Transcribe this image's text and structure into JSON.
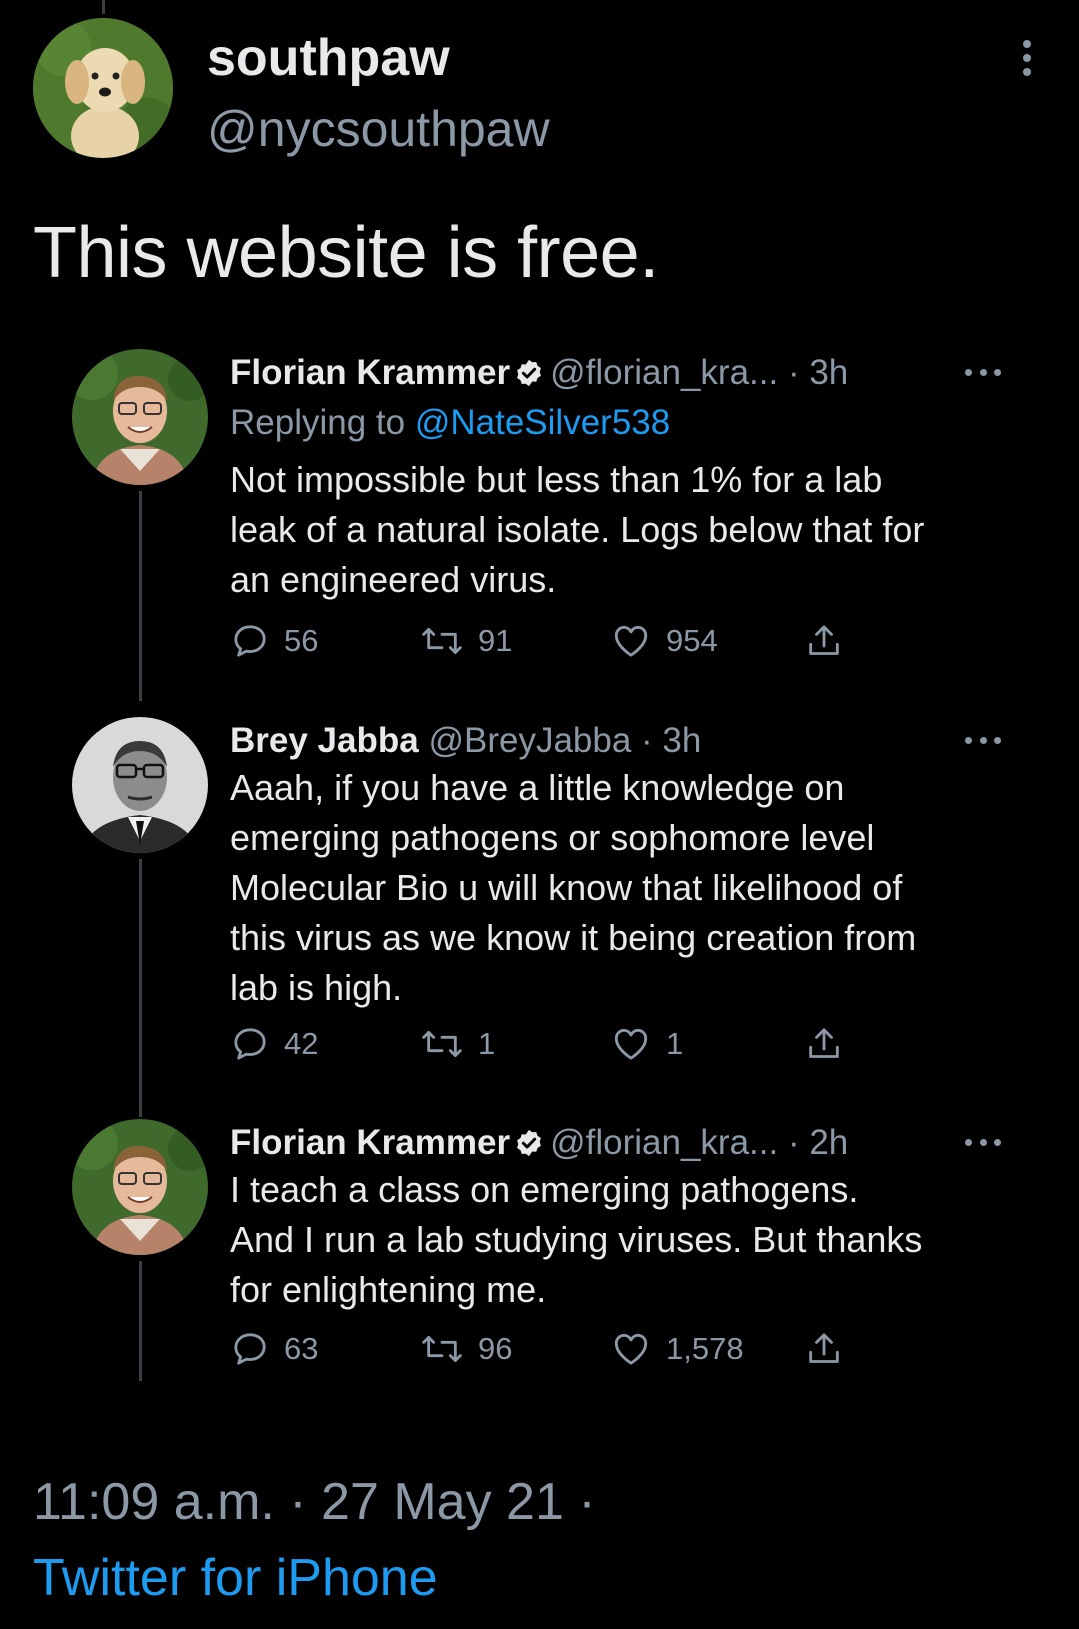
{
  "author": {
    "name": "southpaw",
    "handle": "@nycsouthpaw"
  },
  "tweet": {
    "text": "This website is free.",
    "timestamp": "11:09 a.m. · 27 May 21 ·",
    "source": "Twitter for iPhone"
  },
  "replies": [
    {
      "name": "Florian Krammer",
      "verified": true,
      "handle": "@florian_kra...",
      "time": "· 3h",
      "replying_prefix": "Replying to",
      "replying_to": "@NateSilver538",
      "lines": [
        "Not impossible but less than 1% for a lab",
        "leak of a natural isolate. Logs below that for",
        "an engineered virus."
      ],
      "replies": "56",
      "retweets": "91",
      "likes": "954"
    },
    {
      "name": "Brey Jabba",
      "verified": false,
      "handle": "@BreyJabba",
      "time": "· 3h",
      "lines": [
        "Aaah, if you have a little knowledge on",
        "emerging pathogens or sophomore level",
        "Molecular Bio u will know that likelihood of",
        "this virus as we know it being creation from",
        "lab is high."
      ],
      "replies": "42",
      "retweets": "1",
      "likes": "1"
    },
    {
      "name": "Florian Krammer",
      "verified": true,
      "handle": "@florian_kra...",
      "time": "· 2h",
      "lines": [
        "I teach a class on emerging pathogens.",
        "And I run a lab studying viruses. But thanks",
        "for enlightening me."
      ],
      "replies": "63",
      "retweets": "96",
      "likes": "1,578"
    }
  ],
  "icons": {
    "reply": "reply-icon",
    "retweet": "retweet-icon",
    "like": "heart-icon",
    "share": "share-icon",
    "more": "more-icon",
    "verified": "verified-icon"
  },
  "colors": {
    "background": "#000000",
    "text": "#e7e9ea",
    "muted": "#8b98a5",
    "link": "#1d9bf0"
  }
}
